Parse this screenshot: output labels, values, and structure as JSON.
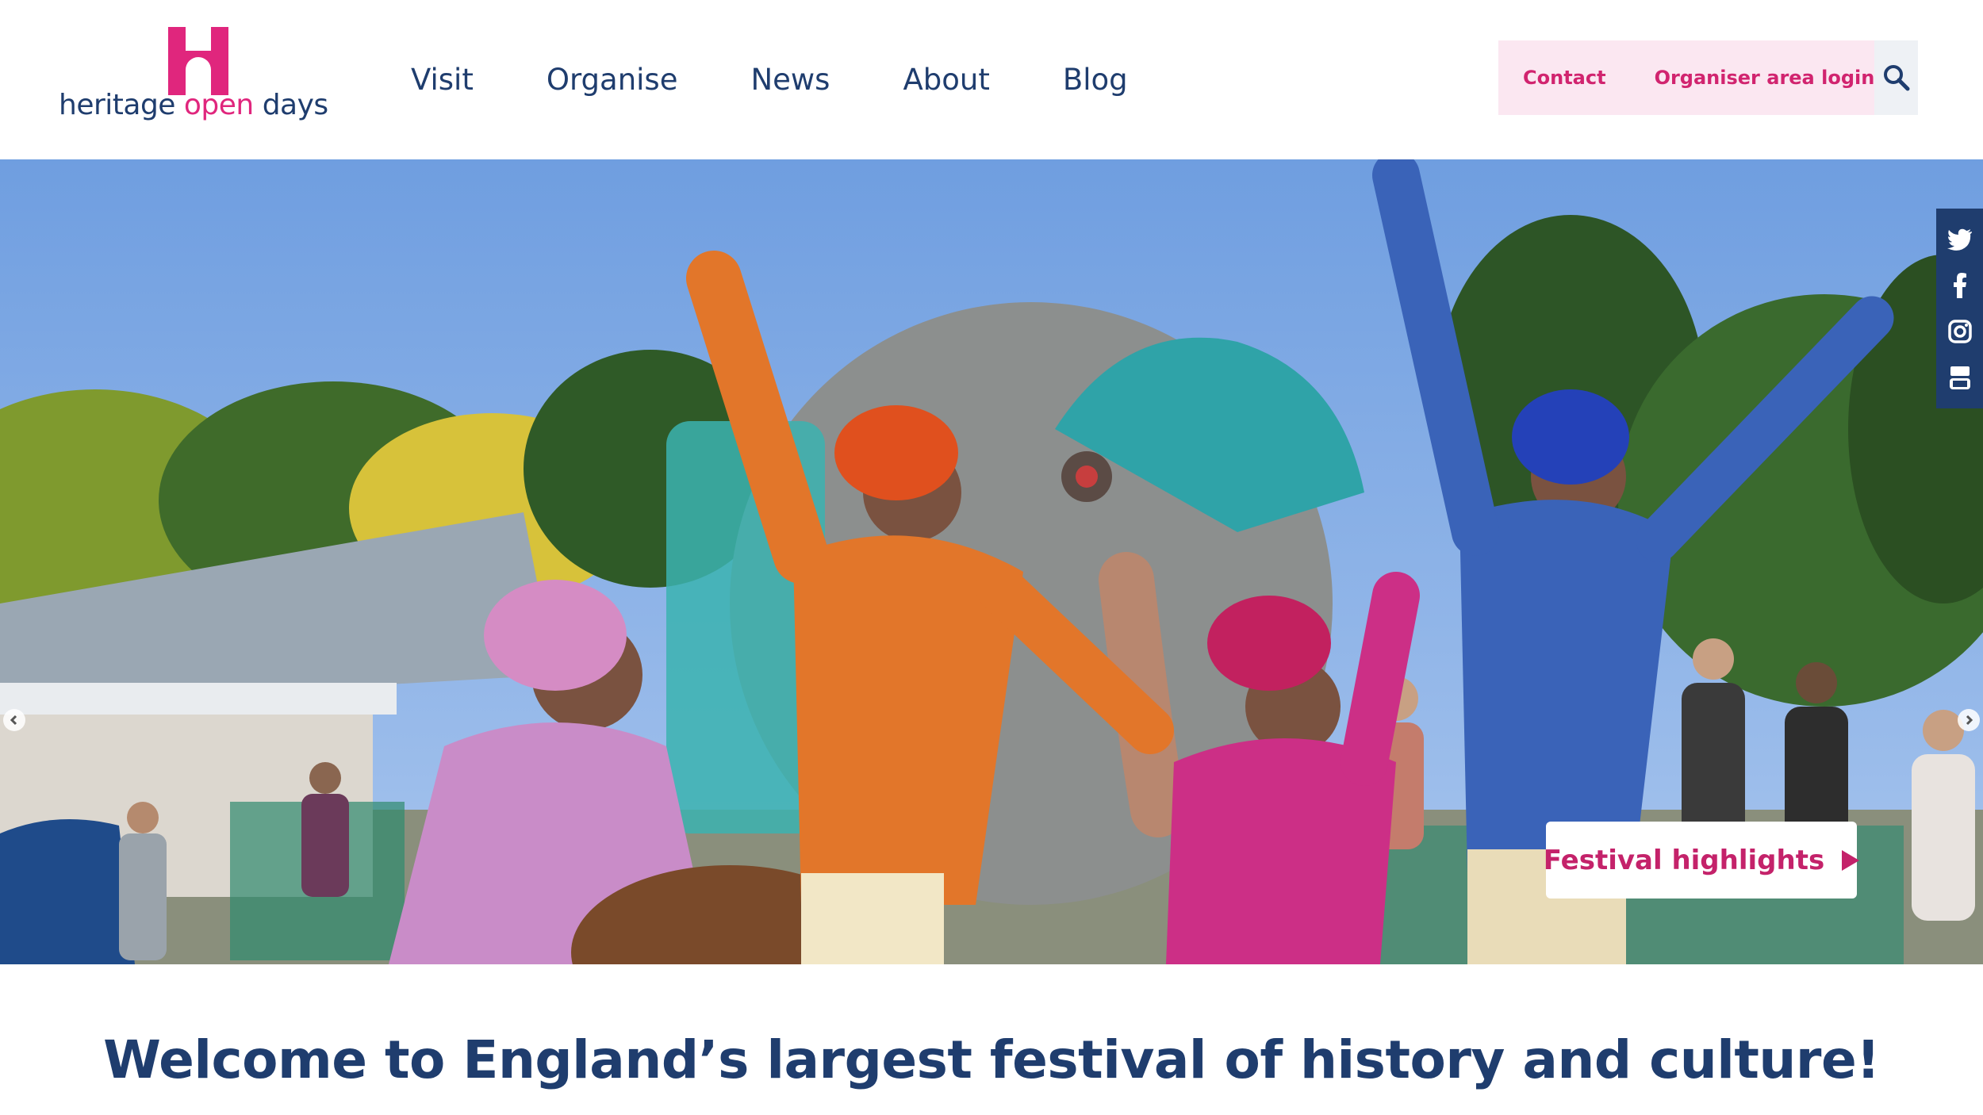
{
  "brand": {
    "logo_prefix": "heritage",
    "logo_highlight": "open",
    "logo_suffix": "days",
    "pink": "#e0267d",
    "navy": "#1f3d6e"
  },
  "nav": {
    "items": [
      {
        "label": "Visit"
      },
      {
        "label": "Organise"
      },
      {
        "label": "News"
      },
      {
        "label": "About"
      },
      {
        "label": "Blog"
      }
    ]
  },
  "utility": {
    "contact": "Contact",
    "login": "Organiser area login",
    "search_icon": "search-icon"
  },
  "hero": {
    "description": "photo of performers in bright festival dress dancing beside a large elephant sculpture",
    "cta_label": "Festival highlights",
    "prev_icon": "chevron-left-icon",
    "next_icon": "chevron-right-icon"
  },
  "social": {
    "items": [
      "twitter-icon",
      "facebook-icon",
      "instagram-icon",
      "youtube-icon"
    ]
  },
  "welcome": {
    "title": "Welcome to England’s largest festival of history and culture!"
  }
}
